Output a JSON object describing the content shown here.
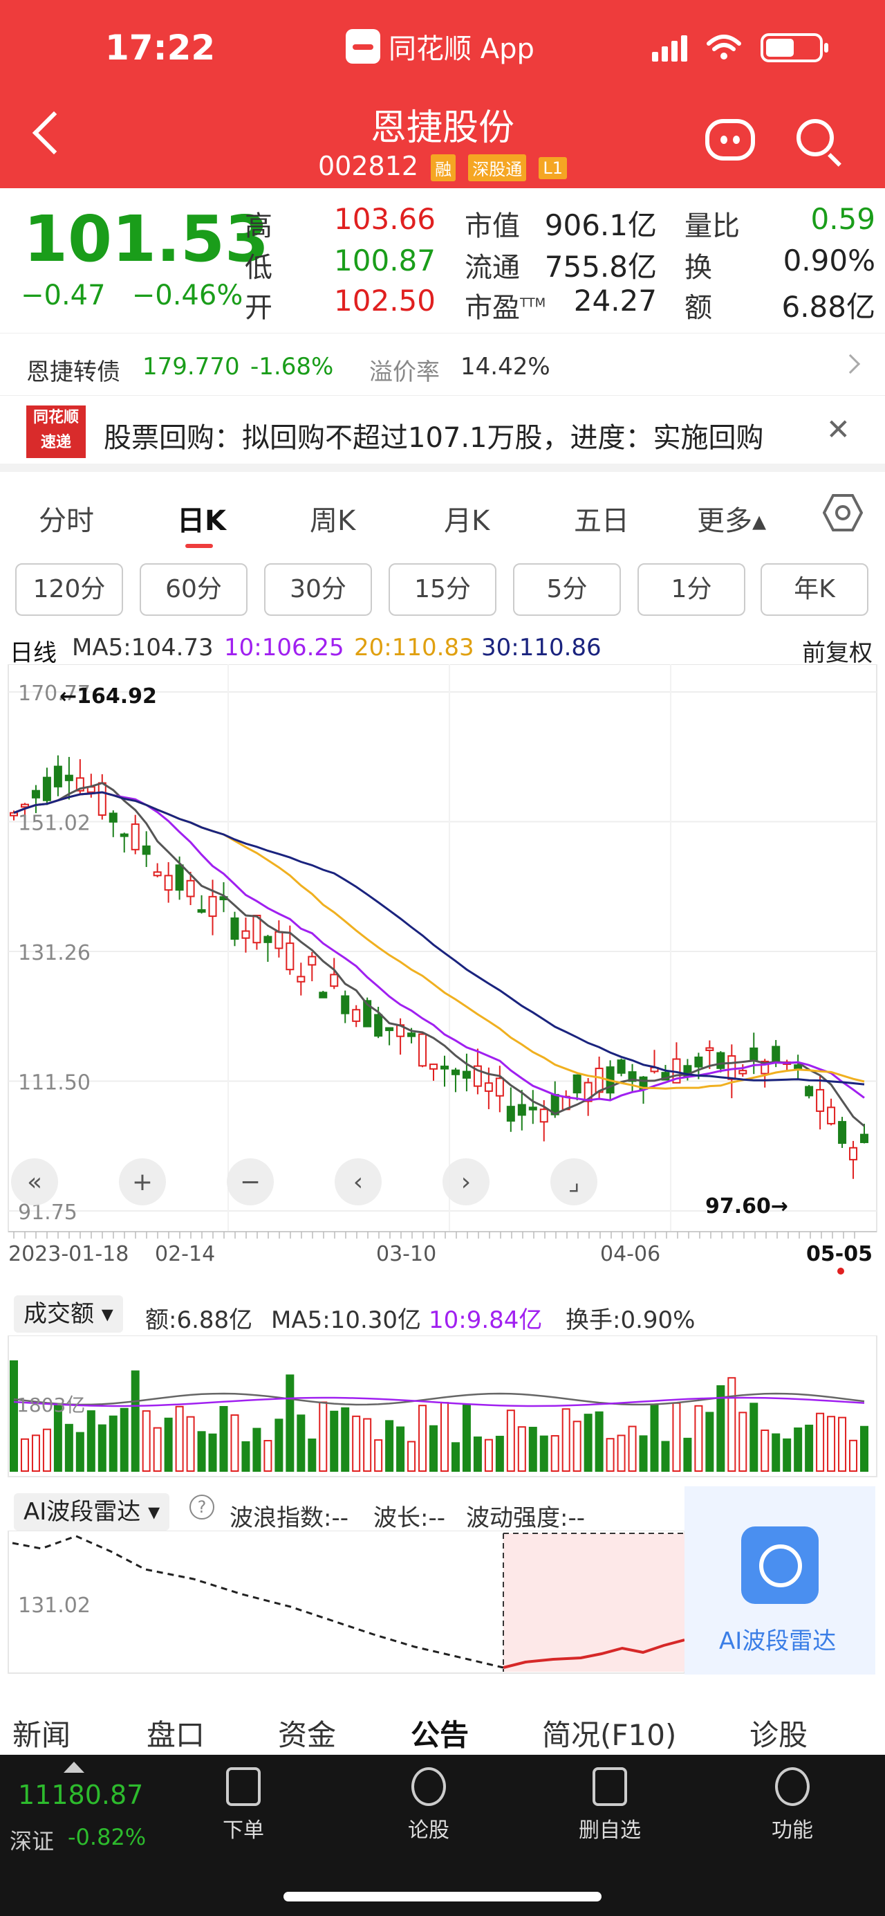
{
  "status": {
    "time": "17:22",
    "app": "同花顺 App"
  },
  "header": {
    "name": "恩捷股份",
    "code": "002812",
    "tags": [
      "融",
      "深股通",
      "L1"
    ]
  },
  "quote": {
    "price": "101.53",
    "change": "−0.47",
    "change_pct": "−0.46%",
    "high_label": "高",
    "high": "103.66",
    "low_label": "低",
    "low": "100.87",
    "open_label": "开",
    "open": "102.50",
    "mcap_label": "市值",
    "mcap": "906.1亿",
    "float_label": "流通",
    "float": "755.8亿",
    "pe_label": "市盈",
    "pe_sup": "TTM",
    "pe": "24.27",
    "vr_label": "量比",
    "vr": "0.59",
    "turnover_label": "换",
    "turnover": "0.90%",
    "amount_label": "额",
    "amount": "6.88亿"
  },
  "bond": {
    "name": "恩捷转债",
    "price": "179.770",
    "change": "-1.68%",
    "premium_label": "溢价率",
    "premium": "14.42%"
  },
  "news": {
    "logo_top": "同花顺",
    "logo_bottom": "速递",
    "text": "股票回购：拟回购不超过107.1万股，进度：实施回购"
  },
  "period_tabs": [
    "分时",
    "日K",
    "周K",
    "月K",
    "五日",
    "更多▴"
  ],
  "minute_tabs": [
    "120分",
    "60分",
    "30分",
    "15分",
    "5分",
    "1分",
    "年K"
  ],
  "ma": {
    "label": "日线",
    "ma5": "MA5:104.73",
    "ma10": "10:106.25",
    "ma20": "20:110.83",
    "ma30": "30:110.86",
    "adjust": "前复权"
  },
  "colors": {
    "up": "#e02020",
    "down": "#1a7f1a",
    "ma5": "#555555",
    "ma10": "#a020f0",
    "ma20": "#f0b020",
    "ma30": "#1a237e",
    "header": "#ee3c3c"
  },
  "chart_data": {
    "type": "candlestick",
    "y_ticks": [
      "170.77",
      "151.02",
      "131.26",
      "111.50",
      "91.75"
    ],
    "ylim": [
      91.75,
      170.77
    ],
    "x_ticks": [
      "2023-01-18",
      "02-14",
      "03-10",
      "04-06",
      "05-05"
    ],
    "max_mark": "←164.92",
    "min_mark": "97.60→",
    "controls": [
      "«",
      "+",
      "−",
      "‹",
      "›",
      "⌟"
    ]
  },
  "volume": {
    "dropdown": "成交额 ▾",
    "amount": "额:6.88亿",
    "ma5": "MA5:10.30亿",
    "ma10": "10:9.84亿",
    "turnover": "换手:0.90%",
    "axis_label": "1803亿"
  },
  "ai_radar": {
    "dropdown": "AI波段雷达 ▾",
    "help": "?",
    "wave_index": "波浪指数:--",
    "wavelength": "波长:--",
    "strength": "波动强度:--",
    "axis_label": "131.02",
    "badge": "AI波段雷达"
  },
  "bottom_tabs": [
    "新闻",
    "盘口",
    "资金",
    "公告",
    "简况(F10)",
    "诊股"
  ],
  "footer": {
    "index_value": "11180.87",
    "index_name": "深证",
    "index_change": "-0.82%",
    "buttons": [
      "下单",
      "论股",
      "删自选",
      "功能"
    ]
  }
}
